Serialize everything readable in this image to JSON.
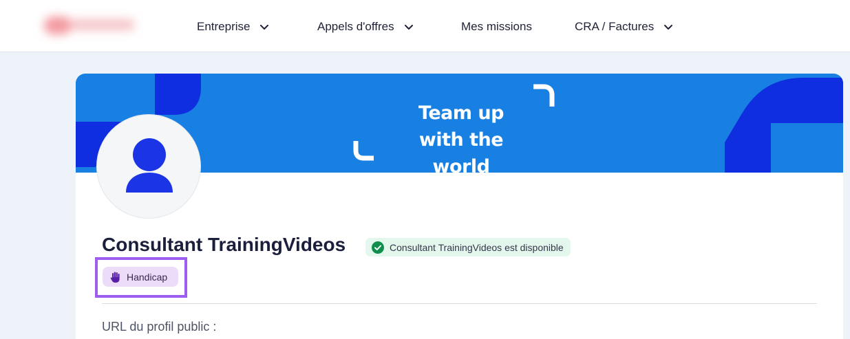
{
  "nav": {
    "items": [
      {
        "label": "Entreprise",
        "has_dropdown": true,
        "icon": "chevron-down-icon"
      },
      {
        "label": "Appels d'offres",
        "has_dropdown": true,
        "icon": "chevron-down-icon"
      },
      {
        "label": "Mes missions",
        "has_dropdown": false
      },
      {
        "label": "CRA / Factures",
        "has_dropdown": true,
        "icon": "chevron-down-icon"
      }
    ]
  },
  "banner": {
    "line1": "Team up",
    "line2": "with the world",
    "color": "#1980e3",
    "accent": "#0f2ee0"
  },
  "profile": {
    "name": "Consultant TrainingVideos",
    "availability": "Consultant TrainingVideos est disponible",
    "availability_icon": "check-circle-icon",
    "handicap_label": "Handicap",
    "handicap_icon": "hand-icon",
    "public_url_label": "URL du profil public :"
  },
  "colors": {
    "availability_bg": "#e4f7ec",
    "availability_icon": "#0e8f4e",
    "handicap_bg": "#eddcf9",
    "handicap_icon": "#5a1fa8",
    "highlight_frame": "#9e5cf0",
    "avatar_icon": "#1b35e6"
  }
}
